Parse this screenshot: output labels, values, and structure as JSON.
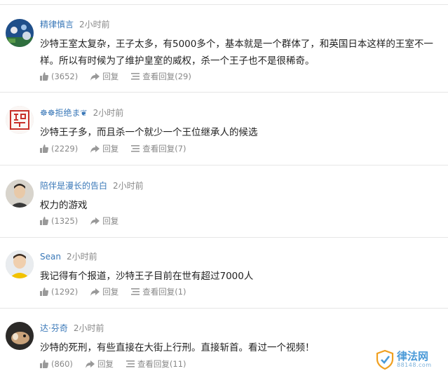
{
  "comments": [
    {
      "user": "精律慎言",
      "time": "2小时前",
      "text": "沙特王室太复杂，王子太多，有5000多个，基本就是一个群体了，和英国日本这样的王室不一样。所以有时候为了维护皇室的威权，杀一个王子也不是很稀奇。",
      "likes": "(3652)",
      "reply_label": "回复",
      "view_replies": "查看回复(29)",
      "avatar_icon": "aquarium-avatar"
    },
    {
      "user": "☸☸拒绝ま❦",
      "time": "2小时前",
      "text": "沙特王子多，而且杀一个就少一个王位继承人的候选",
      "likes": "(2229)",
      "reply_label": "回复",
      "view_replies": "查看回复(7)",
      "avatar_icon": "red-seal-avatar"
    },
    {
      "user": "陪伴是漫长的告白",
      "time": "2小时前",
      "text": "权力的游戏",
      "likes": "(1325)",
      "reply_label": "回复",
      "avatar_icon": "man-portrait-avatar"
    },
    {
      "user": "Sean",
      "time": "2小时前",
      "text": "我记得有个报道，沙特王子目前在世有超过7000人",
      "likes": "(1292)",
      "reply_label": "回复",
      "view_replies": "查看回复(1)",
      "avatar_icon": "child-portrait-avatar"
    },
    {
      "user": "达·芬奇",
      "time": "2小时前",
      "text": "沙特的死刑，有些直接在大街上行刑。直接斩首。看过一个视频！",
      "likes": "(860)",
      "reply_label": "回复",
      "view_replies": "查看回复(11)",
      "avatar_icon": "animal-avatar"
    }
  ],
  "watermark": {
    "brand": "律法网",
    "site": "88148.com",
    "icon": "shield-logo-icon"
  },
  "colors": {
    "username": "#3a78b8",
    "meta_gray": "#888888",
    "divider": "#e6e6e6",
    "watermark_blue": "#4a9ad8"
  }
}
